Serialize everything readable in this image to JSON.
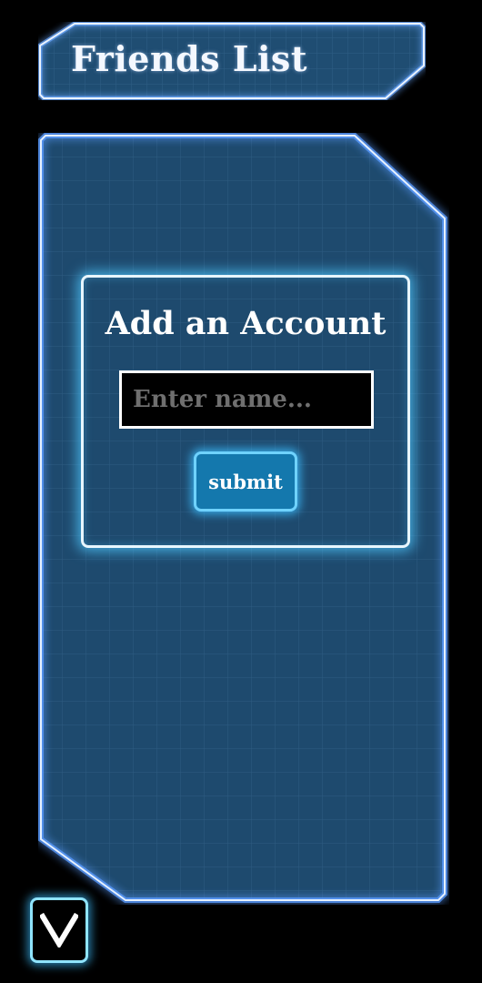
{
  "header": {
    "title": "Friends List"
  },
  "add_account": {
    "heading": "Add an Account",
    "name_input": {
      "value": "",
      "placeholder": "Enter name..."
    },
    "submit_label": "submit"
  },
  "toggle": {
    "icon": "chevron-down-icon"
  },
  "colors": {
    "background": "#000000",
    "panel_fill": "#1e4a6e",
    "panel_glow": "#5aa0ff",
    "accent": "#1478ad"
  }
}
